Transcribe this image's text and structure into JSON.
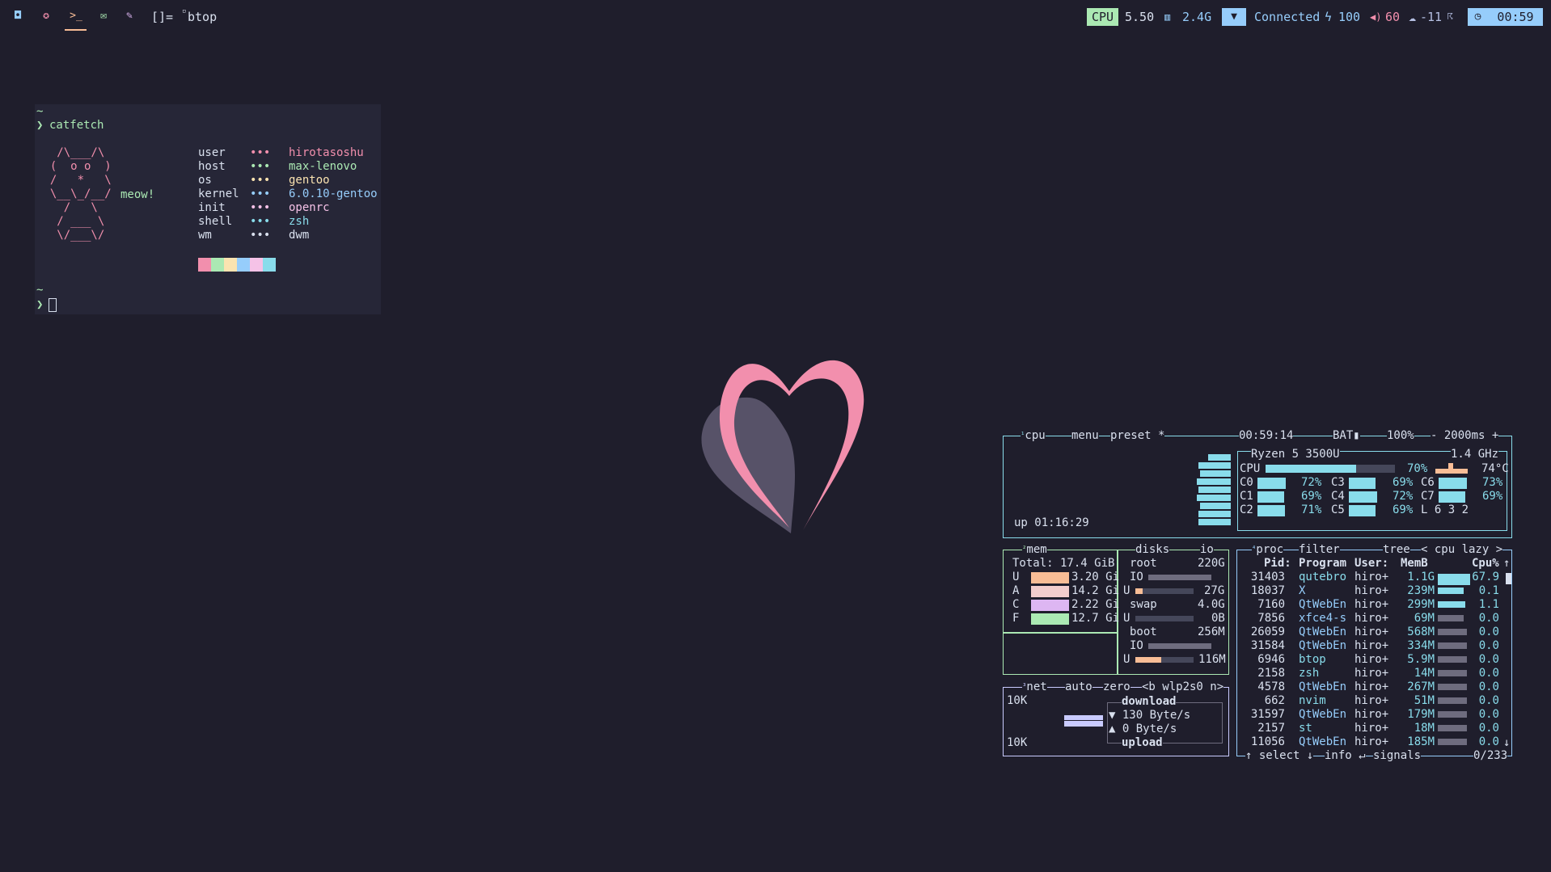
{
  "topbar": {
    "workspaces": [
      {
        "icon": "square-icon",
        "glyph": "◘",
        "color": "#96cdfb"
      },
      {
        "icon": "fire-icon",
        "glyph": "✪",
        "color": "#f28fad"
      },
      {
        "icon": "terminal-icon",
        "glyph": ">_",
        "color": "#f8bd96",
        "active": true
      },
      {
        "icon": "mail-icon",
        "glyph": "✉",
        "color": "#abe9b3"
      },
      {
        "icon": "brush-icon",
        "glyph": "✎",
        "color": "#ddb6f2"
      }
    ],
    "layout": "[]=",
    "window_title": "btop",
    "cpu_label": "CPU",
    "cpu_value": "5.50",
    "mem_value": "2.4G",
    "wifi_status": "Connected",
    "battery": "100",
    "volume": "60",
    "temperature": "-11",
    "clock": "00:59"
  },
  "terminal": {
    "tilde": "~",
    "prompt": "❯",
    "command": "catfetch",
    "art": [
      "   /\\___/\\",
      "  (  o o  )",
      "  /   *   \\",
      "  \\__\\_/__/ ",
      "    /   \\",
      "   / ___ \\",
      "   \\/___\\/"
    ],
    "meow": "meow!",
    "dots": "•••",
    "info": [
      {
        "key": "user",
        "value": "hirotasoshu",
        "color": "#f28fad"
      },
      {
        "key": "host",
        "value": "max-lenovo",
        "color": "#abe9b3"
      },
      {
        "key": "os",
        "value": "gentoo",
        "color": "#fae3b0"
      },
      {
        "key": "kernel",
        "value": "6.0.10-gentoo",
        "color": "#96cdfb"
      },
      {
        "key": "init",
        "value": "openrc",
        "color": "#f5c2e7"
      },
      {
        "key": "shell",
        "value": "zsh",
        "color": "#89dceb"
      },
      {
        "key": "wm",
        "value": "dwm",
        "color": "#d9e0ee"
      }
    ],
    "swatches": [
      "#f28fad",
      "#abe9b3",
      "#fae3b0",
      "#96cdfb",
      "#f5c2e7",
      "#89dceb"
    ]
  },
  "btop": {
    "cpu": {
      "title": "cpu",
      "title_num": "¹",
      "menu": "menu",
      "preset": "preset *",
      "time": "00:59:14",
      "bat_label": "BAT▮",
      "bat": "100%",
      "interval": "- 2000ms +",
      "model": "Ryzen 5 3500U",
      "freq": "1.4 GHz",
      "total_label": "CPU",
      "total_pct": "70%",
      "total_fill": 0.7,
      "temp": "74°C",
      "uptime": "up 01:16:29",
      "cores": [
        {
          "name": "C0",
          "pct": "72%",
          "fill": 0.72
        },
        {
          "name": "C1",
          "pct": "69%",
          "fill": 0.69
        },
        {
          "name": "C2",
          "pct": "71%",
          "fill": 0.71
        },
        {
          "name": "C3",
          "pct": "69%",
          "fill": 0.69
        },
        {
          "name": "C4",
          "pct": "72%",
          "fill": 0.72
        },
        {
          "name": "C5",
          "pct": "69%",
          "fill": 0.69
        },
        {
          "name": "C6",
          "pct": "73%",
          "fill": 0.73
        },
        {
          "name": "C7",
          "pct": "69%",
          "fill": 0.69
        }
      ],
      "load": "L 6 3 2"
    },
    "mem": {
      "title": "mem",
      "title_num": "²",
      "total": "Total: 17.4 GiB",
      "rows": [
        {
          "label": "U",
          "value": "3.20 Gi",
          "color": "#f8bd96"
        },
        {
          "label": "A",
          "value": "14.2 Gi",
          "color": "#f2cdcd"
        },
        {
          "label": "C",
          "value": "2.22 Gi",
          "color": "#ddb6f2"
        },
        {
          "label": "F",
          "value": "12.7 Gi",
          "color": "#abe9b3"
        }
      ]
    },
    "disks": {
      "title": "disks",
      "io": "io",
      "root_label": "root",
      "root_size": "220G",
      "root_io": "IO",
      "root_u": "U",
      "root_used": "27G",
      "root_fill": 0.12,
      "swap_label": "swap",
      "swap_size": "4.0G",
      "swap_u": "U",
      "swap_used": "0B",
      "boot_label": "boot",
      "boot_size": "256M",
      "boot_io": "IO",
      "boot_u": "U",
      "boot_used": "116M",
      "boot_fill": 0.45
    },
    "net": {
      "title": "net",
      "title_num": "³",
      "auto": "auto",
      "zero": "zero",
      "iface": "<b wlp2s0 n>",
      "scale_top": "10K",
      "scale_bottom": "10K",
      "download": "download",
      "down_rate": "▼ 130 Byte/s",
      "up_rate": "▲ 0 Byte/s",
      "upload": "upload"
    },
    "proc": {
      "title": "proc",
      "title_num": "⁴",
      "filter": "filter",
      "tree": "tree",
      "sort": "< cpu lazy >",
      "headers": {
        "pid": "Pid:",
        "program": "Program",
        "user": "User:",
        "mem": "MemB",
        "cpu": "Cpu%"
      },
      "rows": [
        {
          "pid": "31403",
          "program": "qutebro",
          "user": "hiro+",
          "mem": "1.1G",
          "cpu": "67.9",
          "bar": 0.9,
          "pcolor": "#89dceb"
        },
        {
          "pid": "18037",
          "program": "X",
          "user": "hiro+",
          "mem": "239M",
          "cpu": "0.1",
          "bar": 0.8,
          "pcolor": "#96cdfb"
        },
        {
          "pid": "7160",
          "program": "QtWebEn",
          "user": "hiro+",
          "mem": "299M",
          "cpu": "1.1",
          "bar": 0.85,
          "pcolor": "#96cdfb"
        },
        {
          "pid": "7856",
          "program": "xfce4-s",
          "user": "hiro+",
          "mem": "69M",
          "cpu": "0.0",
          "bar": 0.8,
          "pcolor": "#96cdfb"
        },
        {
          "pid": "26059",
          "program": "QtWebEn",
          "user": "hiro+",
          "mem": "568M",
          "cpu": "0.0",
          "bar": 0.9,
          "pcolor": "#96cdfb"
        },
        {
          "pid": "31584",
          "program": "QtWebEn",
          "user": "hiro+",
          "mem": "334M",
          "cpu": "0.0",
          "bar": 0.9,
          "pcolor": "#96cdfb"
        },
        {
          "pid": "6946",
          "program": "btop",
          "user": "hiro+",
          "mem": "5.9M",
          "cpu": "0.0",
          "bar": 0.9,
          "pcolor": "#89dceb"
        },
        {
          "pid": "2158",
          "program": "zsh",
          "user": "hiro+",
          "mem": "14M",
          "cpu": "0.0",
          "bar": 0.9,
          "pcolor": "#89dceb"
        },
        {
          "pid": "4578",
          "program": "QtWebEn",
          "user": "hiro+",
          "mem": "267M",
          "cpu": "0.0",
          "bar": 0.9,
          "pcolor": "#96cdfb"
        },
        {
          "pid": "662",
          "program": "nvim",
          "user": "hiro+",
          "mem": "51M",
          "cpu": "0.0",
          "bar": 0.9,
          "pcolor": "#89dceb"
        },
        {
          "pid": "31597",
          "program": "QtWebEn",
          "user": "hiro+",
          "mem": "179M",
          "cpu": "0.0",
          "bar": 0.9,
          "pcolor": "#96cdfb"
        },
        {
          "pid": "2157",
          "program": "st",
          "user": "hiro+",
          "mem": "18M",
          "cpu": "0.0",
          "bar": 0.9,
          "pcolor": "#89dceb"
        },
        {
          "pid": "11056",
          "program": "QtWebEn",
          "user": "hiro+",
          "mem": "185M",
          "cpu": "0.0",
          "bar": 0.9,
          "pcolor": "#96cdfb"
        }
      ],
      "footer_select": "↑ select ↓",
      "footer_info": "info ↵",
      "footer_signals": "signals",
      "count": "0/233"
    }
  },
  "colors": {
    "bg": "#1f1e2c",
    "term_bg": "#262637",
    "fg": "#d9e0ee",
    "cpu_border": "#89dceb",
    "mem_border": "#abe9b3",
    "net_border": "#c9cbff",
    "proc_border": "#96cdfb",
    "heart": "#f28fad",
    "heart_shadow": "#575268",
    "clock_chip": "#96cdfb"
  }
}
